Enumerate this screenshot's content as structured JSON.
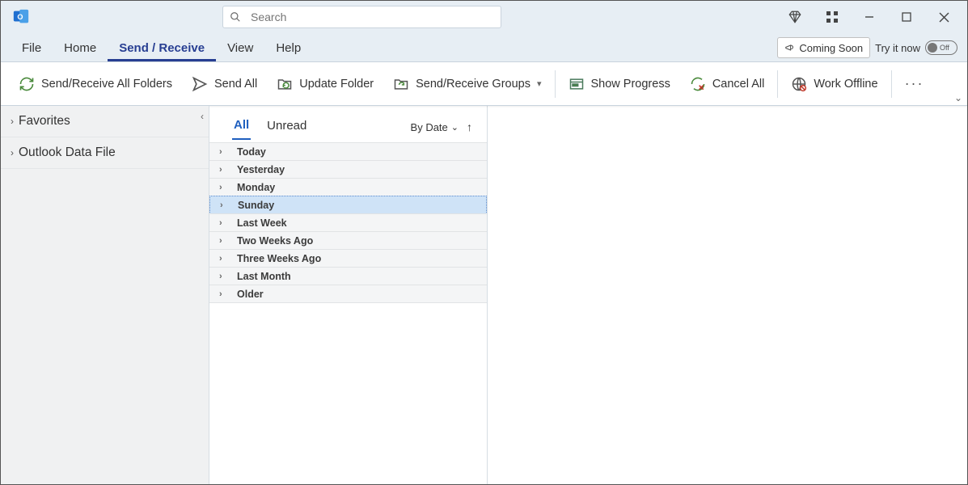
{
  "search": {
    "placeholder": "Search"
  },
  "menu": {
    "items": [
      "File",
      "Home",
      "Send / Receive",
      "View",
      "Help"
    ],
    "active": "Send / Receive",
    "coming_soon": "Coming Soon",
    "try_it_now": "Try it now",
    "toggle_label": "Off"
  },
  "ribbon": {
    "send_receive_all": "Send/Receive All Folders",
    "send_all": "Send All",
    "update_folder": "Update Folder",
    "sr_groups": "Send/Receive Groups",
    "show_progress": "Show Progress",
    "cancel_all": "Cancel All",
    "work_offline": "Work Offline"
  },
  "nav": {
    "items": [
      {
        "label": "Favorites"
      },
      {
        "label": "Outlook Data File"
      }
    ]
  },
  "list": {
    "tabs": {
      "all": "All",
      "unread": "Unread"
    },
    "sort_by": "By Date",
    "groups": [
      {
        "label": "Today",
        "selected": false
      },
      {
        "label": "Yesterday",
        "selected": false
      },
      {
        "label": "Monday",
        "selected": false
      },
      {
        "label": "Sunday",
        "selected": true
      },
      {
        "label": "Last Week",
        "selected": false
      },
      {
        "label": "Two Weeks Ago",
        "selected": false
      },
      {
        "label": "Three Weeks Ago",
        "selected": false
      },
      {
        "label": "Last Month",
        "selected": false
      },
      {
        "label": "Older",
        "selected": false
      }
    ]
  }
}
